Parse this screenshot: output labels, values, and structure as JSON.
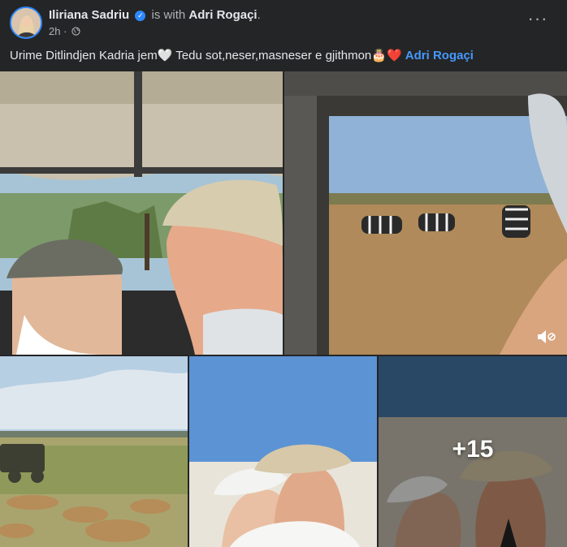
{
  "post": {
    "author": "Iliriana Sadriu",
    "with_text": "is with",
    "tagged": "Adri Rogaçi",
    "period": ".",
    "time": "2h",
    "more_label": "···",
    "caption_text": "Urime Ditlindjen Kadria jem🤍 Tedu sot,neser,masneser e gjithmon🎂❤️",
    "caption_tag": "Adri Rogaçi"
  },
  "gallery": {
    "more_count": "+15"
  },
  "colors": {
    "background": "#242526",
    "link": "#4599ff",
    "verified": "#2d88ff",
    "muted": "#b0b3b8"
  },
  "icons": [
    "verified-badge-icon",
    "globe-icon",
    "more-options-icon",
    "volume-muted-icon"
  ]
}
